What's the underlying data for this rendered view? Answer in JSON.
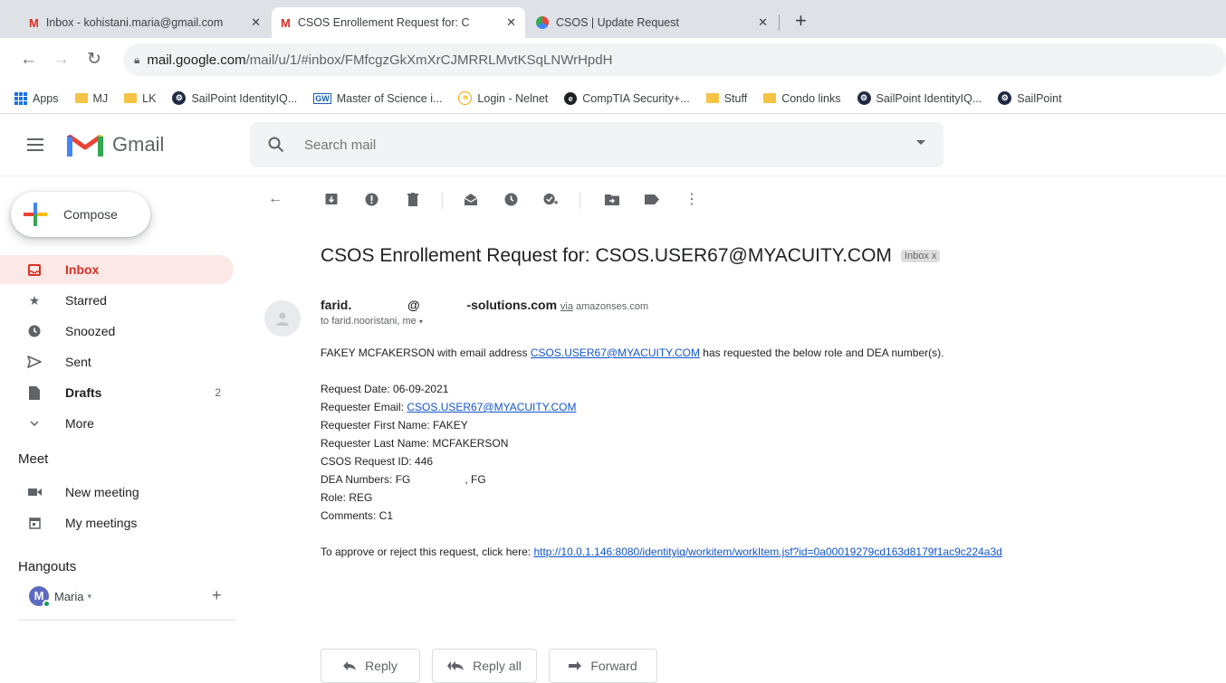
{
  "browser": {
    "tabs": [
      {
        "title": "Inbox - kohistani.maria@gmail.com",
        "favicon": "gmail-icon",
        "active": false
      },
      {
        "title": "CSOS Enrollement Request for: C",
        "favicon": "gmail-icon",
        "active": true
      },
      {
        "title": "CSOS | Update Request",
        "favicon": "csos-icon",
        "active": false
      }
    ],
    "new_tab": "+",
    "url_host": "mail.google.com",
    "url_path": "/mail/u/1/#inbox/FMfcgzGkXmXrCJMRRLMvtKSqLNWrHpdH",
    "bookmarks": [
      {
        "label": "Apps",
        "icon": "apps-grid-icon"
      },
      {
        "label": "MJ",
        "icon": "folder-icon"
      },
      {
        "label": "LK",
        "icon": "folder-icon"
      },
      {
        "label": "SailPoint IdentityIQ...",
        "icon": "sailpoint-icon"
      },
      {
        "label": "Master of Science i...",
        "icon": "gw-icon"
      },
      {
        "label": "Login - Nelnet",
        "icon": "nelnet-icon"
      },
      {
        "label": "CompTIA Security+...",
        "icon": "comptia-icon"
      },
      {
        "label": "Stuff",
        "icon": "folder-icon"
      },
      {
        "label": "Condo links",
        "icon": "folder-icon"
      },
      {
        "label": "SailPoint IdentityIQ...",
        "icon": "sailpoint-icon"
      },
      {
        "label": "SailPoint",
        "icon": "sailpoint-icon"
      }
    ]
  },
  "gmail": {
    "wordmark": "Gmail",
    "search_placeholder": "Search mail",
    "compose_label": "Compose",
    "nav": [
      {
        "label": "Inbox",
        "icon": "inbox-icon",
        "count": ""
      },
      {
        "label": "Starred",
        "icon": "star-icon",
        "count": ""
      },
      {
        "label": "Snoozed",
        "icon": "clock-icon",
        "count": ""
      },
      {
        "label": "Sent",
        "icon": "send-icon",
        "count": ""
      },
      {
        "label": "Drafts",
        "icon": "draft-icon",
        "count": "2"
      },
      {
        "label": "More",
        "icon": "chevron-down-icon",
        "count": ""
      }
    ],
    "meet_title": "Meet",
    "meet_items": [
      {
        "label": "New meeting",
        "icon": "video-icon"
      },
      {
        "label": "My meetings",
        "icon": "calendar-icon"
      }
    ],
    "hangouts_title": "Hangouts",
    "hangouts_user": "Maria",
    "hangouts_avatar_letter": "M"
  },
  "email": {
    "subject": "CSOS Enrollement Request for: CSOS.USER67@MYACUITY.COM",
    "label": "Inbox",
    "label_close": "x",
    "sender_name": "farid.",
    "sender_at": "@",
    "sender_domain": "-solutions.com",
    "via_word": "via",
    "via_domain": "amazonses.com",
    "to_line": "to farid.nooristani, me",
    "intro_pre": "FAKEY MCFAKERSON with email address ",
    "intro_link": "CSOS.USER67@MYACUITY.COM",
    "intro_post": " has requested the below role and DEA number(s).",
    "request_date": "Request Date: 06-09-2021",
    "requester_email_label": "Requester Email: ",
    "requester_email": "CSOS.USER67@MYACUITY.COM",
    "first_name": "Requester First Name: FAKEY",
    "last_name": "Requester Last Name: MCFAKERSON",
    "request_id": "CSOS Request ID: 446",
    "dea_label": "DEA Numbers: FG",
    "dea_mid": ", FG",
    "role": "Role: REG",
    "comments": "Comments: C1",
    "approve_text": "To approve or reject this request, click here: ",
    "approve_link": "http://10.0.1.146:8080/identityiq/workitem/workItem.jsf?id=0a00019279cd163d8179f1ac9c224a3d"
  },
  "actions": {
    "reply": "Reply",
    "reply_all": "Reply all",
    "forward": "Forward"
  },
  "colors": {
    "accent_red": "#d93025",
    "link_blue": "#1155cc",
    "active_nav_bg": "#fce8e6"
  }
}
